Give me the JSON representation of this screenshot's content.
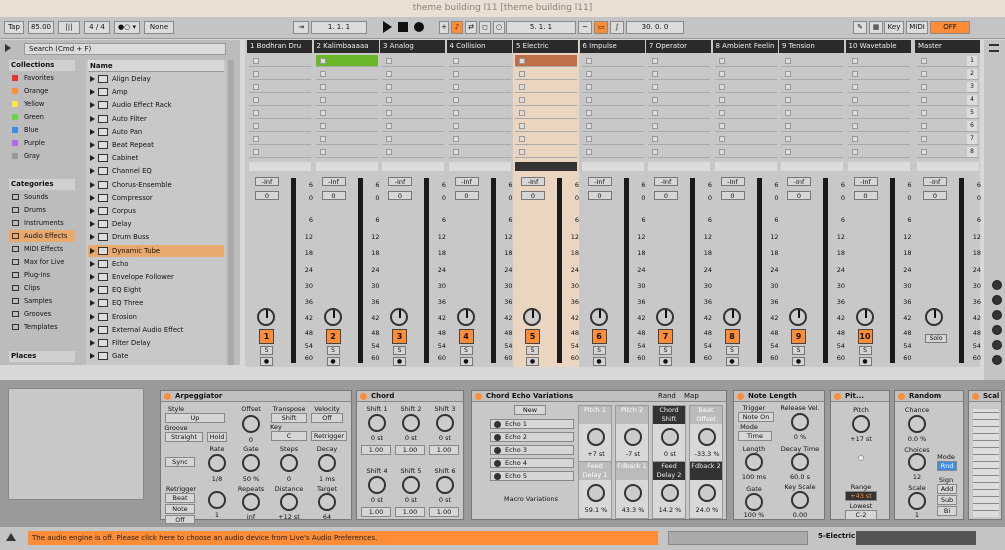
{
  "title": "theme building l11  [theme building l11]",
  "transport": {
    "tap": "Tap",
    "bpm": "85.00",
    "sig": "4 / 4",
    "quant": "None",
    "pos": "1.  1.  1",
    "pos2": "5.  1.  1",
    "pos3": "30.  0.  0",
    "key": "Key",
    "midi": "MIDI",
    "off": "OFF"
  },
  "browser": {
    "search": "Search (Cmd + F)",
    "collections_label": "Collections",
    "collections": [
      {
        "label": "Favorites",
        "color": "#e8352c"
      },
      {
        "label": "Orange",
        "color": "#ff8c36"
      },
      {
        "label": "Yellow",
        "color": "#f5e54a"
      },
      {
        "label": "Green",
        "color": "#6ad34a"
      },
      {
        "label": "Blue",
        "color": "#3c8ce8"
      },
      {
        "label": "Purple",
        "color": "#b46ae8"
      },
      {
        "label": "Gray",
        "color": "#999999"
      }
    ],
    "categories_label": "Categories",
    "categories": [
      "Sounds",
      "Drums",
      "Instruments",
      "Audio Effects",
      "MIDI Effects",
      "Max for Live",
      "Plug-Ins",
      "Clips",
      "Samples",
      "Grooves",
      "Templates"
    ],
    "places_label": "Places",
    "name_header": "Name",
    "files": [
      "Align Delay",
      "Amp",
      "Audio Effect Rack",
      "Auto Filter",
      "Auto Pan",
      "Beat Repeat",
      "Cabinet",
      "Channel EQ",
      "Chorus-Ensemble",
      "Compressor",
      "Corpus",
      "Delay",
      "Drum Buss",
      "Dynamic Tube",
      "Echo",
      "Envelope Follower",
      "EQ Eight",
      "EQ Three",
      "Erosion",
      "External Audio Effect",
      "Filter Delay",
      "Gate"
    ]
  },
  "tracks": [
    {
      "name": "1 Bodhran Dru",
      "num": "1"
    },
    {
      "name": "2 Kalimbaaaaa",
      "num": "2"
    },
    {
      "name": "3 Analog",
      "num": "3"
    },
    {
      "name": "4 Collision",
      "num": "4"
    },
    {
      "name": "5 Electric",
      "num": "5"
    },
    {
      "name": "6 Impulse",
      "num": "6"
    },
    {
      "name": "7 Operator",
      "num": "7"
    },
    {
      "name": "8 Ambient Feelin",
      "num": "8"
    },
    {
      "name": "9 Tension",
      "num": "9"
    },
    {
      "name": "10 Wavetable",
      "num": "10"
    }
  ],
  "master": {
    "name": "Master",
    "scenes": [
      "1",
      "2",
      "3",
      "4",
      "5",
      "6",
      "7",
      "8"
    ],
    "solo": "Solo"
  },
  "mixer": {
    "inf": "-Inf",
    "zero": "0",
    "s": "S",
    "scale": [
      "6",
      "0",
      "6",
      "12",
      "18",
      "24",
      "30",
      "36",
      "42",
      "48",
      "54",
      "60"
    ]
  },
  "arp": {
    "title": "Arpeggiator",
    "style_l": "Style",
    "style": "Up",
    "groove_l": "Groove",
    "groove": "Straight",
    "hold": "Hold",
    "offset_l": "Offset",
    "offset": "0",
    "transpose_l": "Transpose",
    "transpose": "Shift",
    "key_l": "Key",
    "key": "C",
    "velocity_l": "Velocity",
    "velocity": "Off",
    "retrigger_btn": "Retrigger",
    "sync": "Sync",
    "rate_l": "Rate",
    "rate": "1/8",
    "gate_l": "Gate",
    "gate": "50 %",
    "steps_l": "Steps",
    "steps": "0",
    "decay_l": "Decay",
    "decay": "1 ms",
    "retrigger_l": "Retrigger",
    "beat": "Beat",
    "note": "Note",
    "off": "Off",
    "repeats_l": "Repeats",
    "repeats": "inf",
    "distance_l": "Distance",
    "distance": "+12 st",
    "target_l": "Target",
    "target": "64",
    "one": "1"
  },
  "chord": {
    "title": "Chord",
    "shifts": [
      {
        "l": "Shift 1",
        "v": "0 st",
        "b": "1.00"
      },
      {
        "l": "Shift 2",
        "v": "0 st",
        "b": "1.00"
      },
      {
        "l": "Shift 3",
        "v": "0 st",
        "b": "1.00"
      },
      {
        "l": "Shift 4",
        "v": "0 st",
        "b": "1.00"
      },
      {
        "l": "Shift 5",
        "v": "0 st",
        "b": "1.00"
      },
      {
        "l": "Shift 6",
        "v": "0 st",
        "b": "1.00"
      }
    ]
  },
  "rack": {
    "title": "Chord Echo Variations",
    "rand": "Rand",
    "map": "Map",
    "new": "New",
    "chains": [
      "Echo 1",
      "Echo 2",
      "Echo 3",
      "Echo 4",
      "Echo 5"
    ],
    "macro_label": "Macro Variations",
    "macros": [
      {
        "l": "Pitch 1",
        "v": "+7 st"
      },
      {
        "l": "Pitch 2",
        "v": "-7 st"
      },
      {
        "l": "Chord Shift",
        "v": "0 st"
      },
      {
        "l": "Beat Offset",
        "v": "-33.3 %"
      },
      {
        "l": "Feed Delay 1",
        "v": "59.1 %"
      },
      {
        "l": "Fdback 1",
        "v": "43.3 %"
      },
      {
        "l": "Feed Delay 2",
        "v": "14.2 %"
      },
      {
        "l": "Fdback 2",
        "v": "24.0 %"
      }
    ]
  },
  "notelen": {
    "title": "Note Length",
    "trigger_l": "Trigger",
    "trigger": "Note On",
    "release_l": "Release Vel.",
    "release": "0 %",
    "mode_l": "Mode",
    "mode": "Time",
    "length_l": "Length",
    "length": "100 ms",
    "decay_l": "Decay Time",
    "decay": "60.0 s",
    "gate_l": "Gate",
    "gate": "100 %",
    "keyscale_l": "Key Scale",
    "keyscale": "0.00"
  },
  "pitch": {
    "title": "Pit...",
    "pitch_l": "Pitch",
    "pitch": "+17 st",
    "range_l": "Range",
    "range": "+43 st",
    "lowest_l": "Lowest",
    "lowest": "C-2"
  },
  "random": {
    "title": "Random",
    "chance_l": "Chance",
    "chance": "0.0 %",
    "choices_l": "Choices",
    "choices": "12",
    "scale_l": "Scale",
    "scale": "1",
    "mode_l": "Mode",
    "mode": "Rnd",
    "sign_l": "Sign",
    "add": "Add",
    "sub": "Sub",
    "bi": "Bi"
  },
  "scale": {
    "title": "Scal"
  },
  "status": {
    "msg": "The audio engine is off. Please click here to choose an audio device from Live's Audio Preferences.",
    "track": "5-Electric"
  }
}
